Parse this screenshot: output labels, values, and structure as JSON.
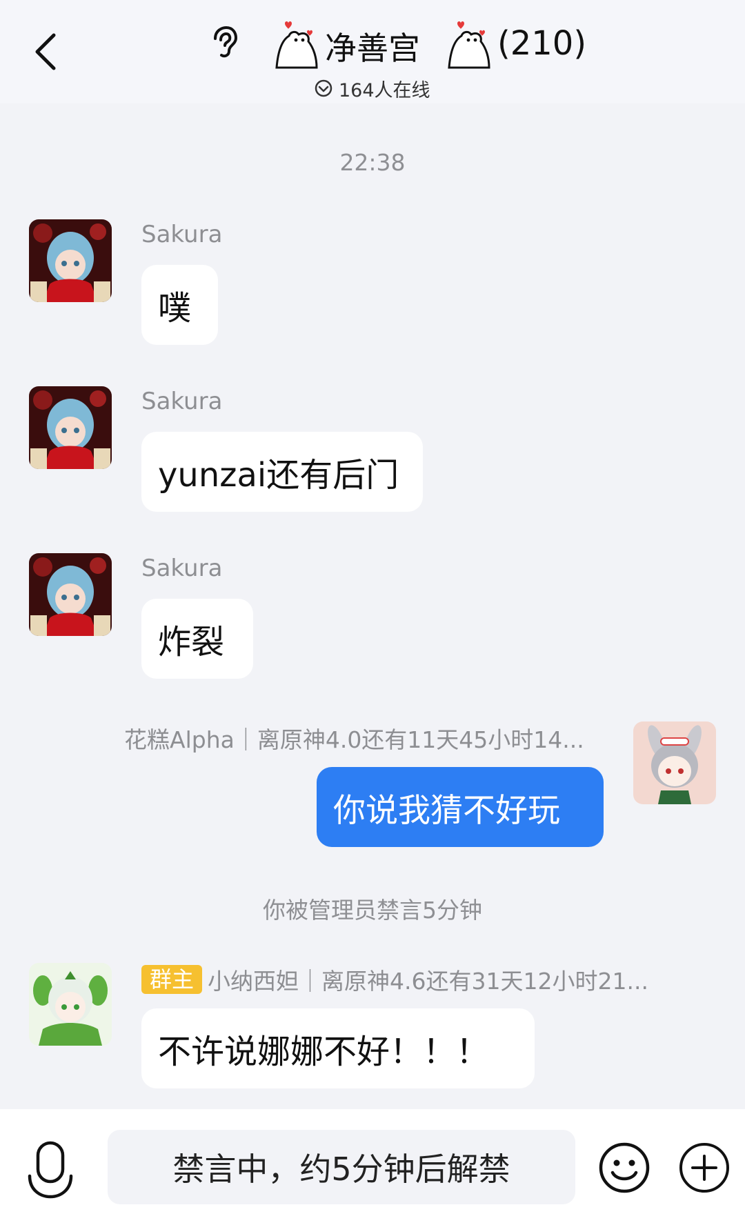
{
  "header": {
    "group_name": "净善宫",
    "member_count": "(210)",
    "online_text": "164人在线"
  },
  "timestamp": "22:38",
  "messages": [
    {
      "sender": "Sakura",
      "text": "噗"
    },
    {
      "sender": "Sakura",
      "text": "yunzai还有后门"
    },
    {
      "sender": "Sakura",
      "text": "炸裂"
    },
    {
      "sender": "花糕Alpha｜离原神4.0还有11天45小时14...",
      "text": "你说我猜不好玩"
    },
    {
      "badge": "群主",
      "sender": "小纳西妲｜离原神4.6还有31天12小时21...",
      "text": "不许说娜娜不好！！！"
    }
  ],
  "system_message": "你被管理员禁言5分钟",
  "input": {
    "muted_text": "禁言中，约5分钟后解禁"
  },
  "icons": {
    "back": "chevron-left-icon",
    "ear": "ear-icon",
    "voice": "microphone-icon",
    "emoji": "smiley-icon",
    "more": "plus-circle-icon"
  },
  "colors": {
    "self_bubble": "#2d7ef3",
    "owner_badge": "#f6c030"
  }
}
